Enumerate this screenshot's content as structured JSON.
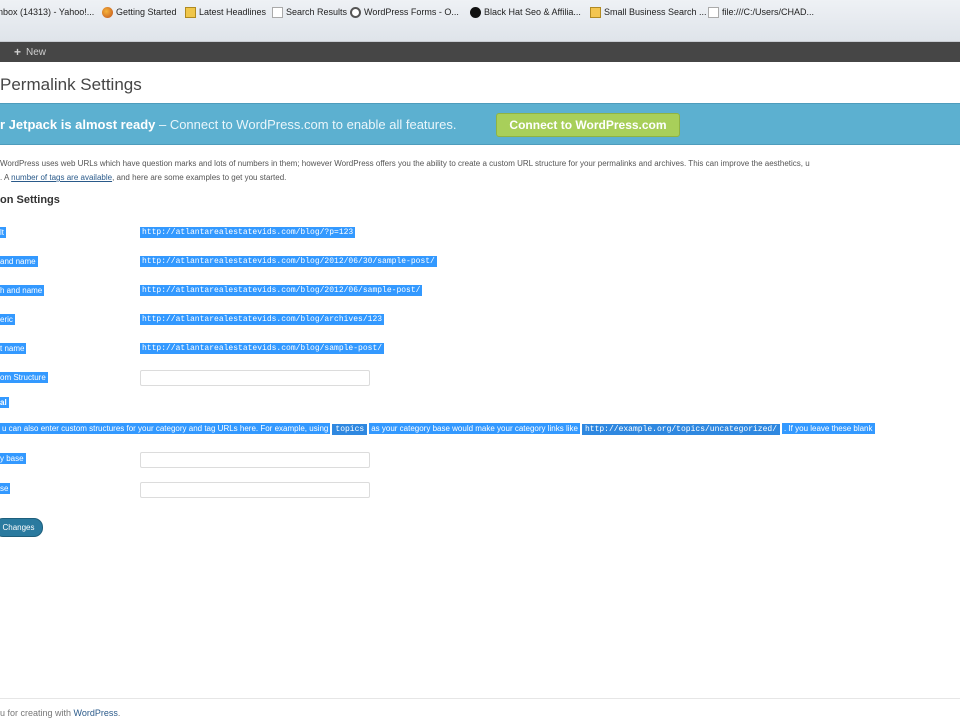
{
  "bookmarks": [
    {
      "icon": "mail-icon",
      "label": "nbox (14313) - Yahoo!..."
    },
    {
      "icon": "firefox-icon",
      "label": "Getting Started"
    },
    {
      "icon": "feed-icon",
      "label": "Latest Headlines"
    },
    {
      "icon": "page-icon",
      "label": "Search Results"
    },
    {
      "icon": "wordpress-icon",
      "label": "WordPress Forms - O..."
    },
    {
      "icon": "blackhat-icon",
      "label": "Black Hat Seo & Affilia..."
    },
    {
      "icon": "folder-icon",
      "label": "Small Business Search ..."
    },
    {
      "icon": "page-icon",
      "label": "file:///C:/Users/CHAD..."
    }
  ],
  "adminbar": {
    "new_label": "New"
  },
  "page_title": "Permalink Settings",
  "jetpack": {
    "bold": "r Jetpack is almost ready",
    "text": " – Connect to WordPress.com to enable all features.",
    "button": "Connect to WordPress.com"
  },
  "intro": {
    "line1": "WordPress uses web URLs which have question marks and lots of numbers in them; however WordPress offers you the ability to create a custom URL structure for your permalinks and archives. This can improve the aesthetics, u",
    "line2_pre": ". A ",
    "line2_link": "number of tags are available",
    "line2_post": ", and here are some examples to get you started."
  },
  "common_settings": {
    "heading": "on Settings",
    "rows": [
      {
        "label": "lt",
        "url": "http://atlantarealestatevids.com/blog/?p=123"
      },
      {
        "label": "and name",
        "url": "http://atlantarealestatevids.com/blog/2012/06/30/sample-post/"
      },
      {
        "label": "h and name",
        "url": "http://atlantarealestatevids.com/blog/2012/06/sample-post/"
      },
      {
        "label": "eric",
        "url": "http://atlantarealestatevids.com/blog/archives/123"
      },
      {
        "label": "t name",
        "url": "http://atlantarealestatevids.com/blog/sample-post/"
      }
    ],
    "custom_label": "om Structure"
  },
  "optional": {
    "heading": "al",
    "desc_pre": "u can also enter custom structures for your category and tag URLs here. For example, using",
    "desc_code1": "topics",
    "desc_mid": "as your category base would make your category links like",
    "desc_code2": "http://example.org/topics/uncategorized/",
    "desc_post": ". If you leave these blank",
    "category_label": "y base",
    "tag_label": "se"
  },
  "save_button": "Changes",
  "footer": {
    "text": "u for creating with ",
    "link": "WordPress",
    "end": "."
  }
}
